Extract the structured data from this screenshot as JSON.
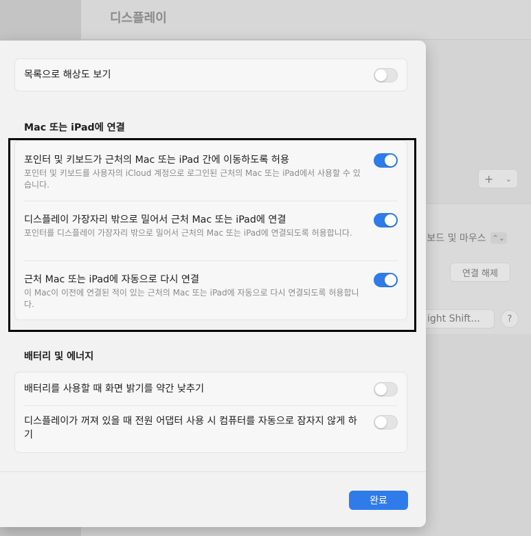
{
  "background": {
    "title": "디스플레이",
    "add_symbol": "+",
    "input_select": "보드 및 마우스",
    "disconnect_label": "연결 해제",
    "shortcut_label": "ight Shift...",
    "help_label": "?"
  },
  "sheet": {
    "list_resolution": {
      "label": "목록으로 해상도 보기",
      "on": false
    },
    "mac_ipad": {
      "title": "Mac 또는 iPad에 연결",
      "items": [
        {
          "label": "포인터 및 키보드가 근처의 Mac 또는 iPad 간에 이동하도록 허용",
          "desc": "포인터 및 키보드를 사용자의 iCloud 계정으로 로그인된 근처의 Mac 또는 iPad에서 사용할 수 있습니다.",
          "on": true
        },
        {
          "label": "디스플레이 가장자리 밖으로 밀어서 근처 Mac 또는 iPad에 연결",
          "desc": "포인터를 디스플레이 가장자리 밖으로 밀어서 근처의 Mac 또는 iPad에 연결되도록 허용합니다.",
          "on": true
        },
        {
          "label": "근처 Mac 또는 iPad에 자동으로 다시 연결",
          "desc": "이 Mac이 이전에 연결된 적이 있는 근처의 Mac 또는 iPad에 자동으로 다시 연결되도록 허용합니다.",
          "on": true
        }
      ]
    },
    "battery": {
      "title": "배터리 및 에너지",
      "items": [
        {
          "label": "배터리를 사용할 때 화면 밝기를 약간 낮추기",
          "on": false
        },
        {
          "label": "디스플레이가 꺼져 있을 때 전원 어댑터 사용 시 컴퓨터를 자동으로 잠자지 않게 하기",
          "on": false
        }
      ]
    },
    "done_label": "완료"
  },
  "colors": {
    "accent": "#2f7bea",
    "toggle_off": "#e4e4e4",
    "sheet_bg": "#f2f2f2"
  }
}
